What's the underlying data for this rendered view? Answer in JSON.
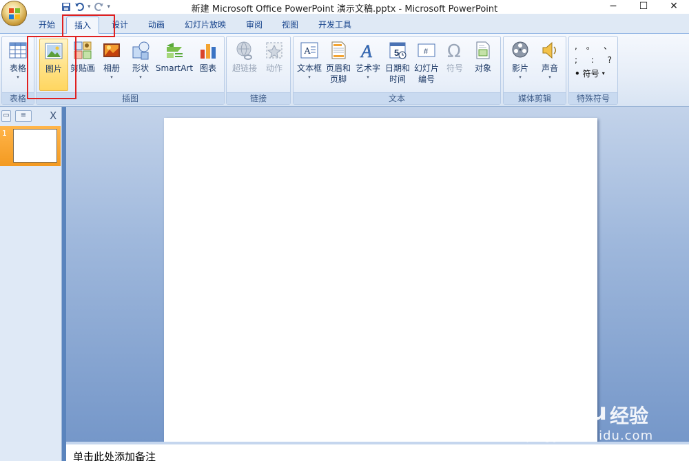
{
  "window": {
    "title": "新建 Microsoft Office PowerPoint 演示文稿.pptx - Microsoft PowerPoint",
    "minimize": "−",
    "maximize": "☐",
    "close": "✕"
  },
  "quick_access": {
    "save": "save-icon",
    "undo": "undo-icon",
    "redo": "redo-icon",
    "customize": "▾"
  },
  "tabs": [
    {
      "label": "开始"
    },
    {
      "label": "插入",
      "active": true
    },
    {
      "label": "设计"
    },
    {
      "label": "动画"
    },
    {
      "label": "幻灯片放映"
    },
    {
      "label": "审阅"
    },
    {
      "label": "视图"
    },
    {
      "label": "开发工具"
    }
  ],
  "ribbon": {
    "groups": {
      "table": "表格",
      "illustrations": "插图",
      "links": "链接",
      "text": "文本",
      "media": "媒体剪辑",
      "special": "特殊符号"
    },
    "buttons": {
      "table": "表格",
      "picture": "图片",
      "clipart": "剪贴画",
      "album": "相册",
      "shapes": "形状",
      "smartart": "SmartArt",
      "chart": "图表",
      "hyperlink": "超链接",
      "action": "动作",
      "textbox": "文本框",
      "header_footer_1": "页眉和",
      "header_footer_2": "页脚",
      "wordart": "艺术字",
      "datetime_1": "日期和",
      "datetime_2": "时间",
      "slide_number_1": "幻灯片",
      "slide_number_2": "编号",
      "symbol": "符号",
      "object": "对象",
      "movie": "影片",
      "sound": "声音",
      "symbols_button": "符号"
    },
    "special_symbols": [
      [
        ",",
        "。",
        "、"
      ],
      [
        ";",
        ":",
        "?"
      ]
    ]
  },
  "slides_pane": {
    "slide_number": "1",
    "close": "X"
  },
  "notes": {
    "placeholder": "单击此处添加备注"
  },
  "watermark": {
    "logo": "Bai du",
    "brand": "经验",
    "url": "jingyan.baidu.com"
  },
  "colors": {
    "ribbon_bg": "#e7eef8",
    "tab_text": "#15428b",
    "selected": "#ffd660",
    "highlight": "#e02020",
    "workspace": "#7597c9"
  }
}
